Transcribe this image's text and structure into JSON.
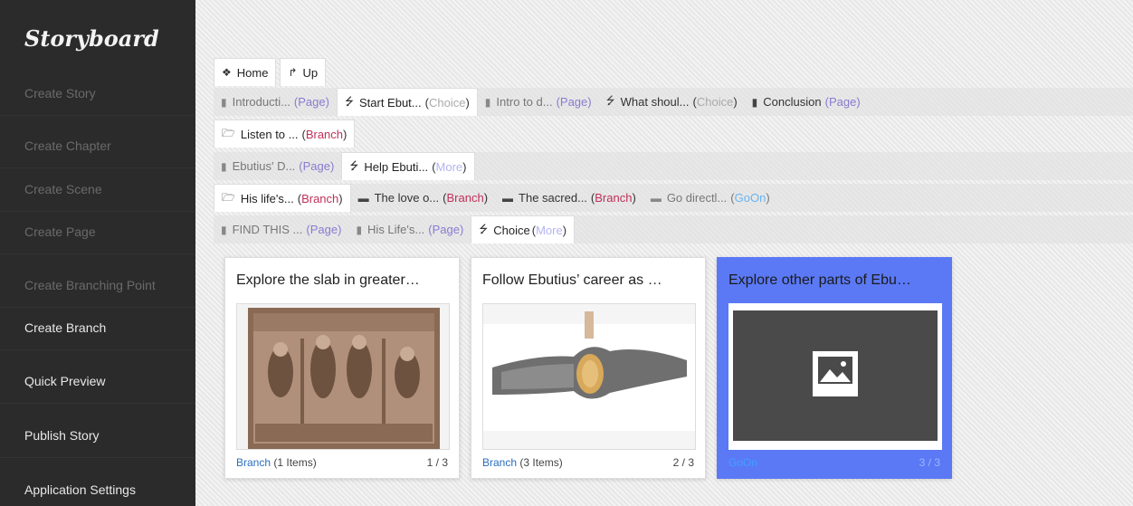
{
  "app": {
    "logo": "Storyboard"
  },
  "sidebar": {
    "items": [
      {
        "label": "Create Story",
        "enabled": false
      },
      {
        "label": "Create Chapter",
        "enabled": false
      },
      {
        "label": "Create Scene",
        "enabled": false
      },
      {
        "label": "Create Page",
        "enabled": false
      },
      {
        "label": "Create Branching Point",
        "enabled": false
      },
      {
        "label": "Create Branch",
        "enabled": true
      },
      {
        "label": "Quick Preview",
        "enabled": true
      },
      {
        "label": "Publish Story",
        "enabled": true
      },
      {
        "label": "Application Settings",
        "enabled": true
      }
    ]
  },
  "nav": {
    "home_label": "Home",
    "up_label": "Up"
  },
  "rows": [
    [
      {
        "icon": "page-icon",
        "name": "Introducti...",
        "kind": "Page"
      },
      {
        "icon": "choice-icon",
        "name": "Start Ebut...",
        "kind": "Choice",
        "active": true
      },
      {
        "icon": "page-icon",
        "name": "Intro to d...",
        "kind": "Page"
      },
      {
        "icon": "choice-icon",
        "name": "What shoul...",
        "kind": "Choice"
      },
      {
        "icon": "page-icon",
        "name": "Conclusion",
        "kind": "Page"
      }
    ],
    [
      {
        "icon": "folder-open-icon",
        "name": "Listen to ...",
        "kind": "Branch",
        "active": true
      }
    ],
    [
      {
        "icon": "page-icon",
        "name": "Ebutius' D...",
        "kind": "Page"
      },
      {
        "icon": "choice-icon",
        "name": "Help Ebuti...",
        "kind": "More",
        "active": true
      }
    ],
    [
      {
        "icon": "folder-open-icon",
        "name": "His life's...",
        "kind": "Branch",
        "active": true
      },
      {
        "icon": "folder-icon",
        "name": "The love o...",
        "kind": "Branch"
      },
      {
        "icon": "folder-icon",
        "name": "The sacred...",
        "kind": "Branch"
      },
      {
        "icon": "folder-icon",
        "name": "Go directl...",
        "kind": "GoOn"
      }
    ],
    [
      {
        "icon": "page-icon",
        "name": "FIND THIS ...",
        "kind": "Page"
      },
      {
        "icon": "page-icon",
        "name": "His Life's...",
        "kind": "Page"
      },
      {
        "icon": "choice-icon",
        "name": "Choice",
        "kind": "More",
        "active": true
      }
    ]
  ],
  "cards": [
    {
      "title": "Explore the slab in greater…",
      "kind": "Branch",
      "count": "(1 Items)",
      "page": "1 / 3",
      "image": "stone-relief"
    },
    {
      "title": "Follow Ebutius’ career as …",
      "kind": "Branch",
      "count": "(3 Items)",
      "page": "2 / 3",
      "image": "iron-tool"
    },
    {
      "title": "Explore other parts of Ebu…",
      "kind": "GoOn",
      "count": "",
      "page": "3 / 3",
      "image": "placeholder-image",
      "selected": true
    }
  ],
  "colors": {
    "sidebar_bg": "#2b2b2b",
    "selected_card": "#5b79f5",
    "page_kind": "#8a7bd0",
    "branch_kind": "#c0305a",
    "goon_kind": "#6ab4f0"
  }
}
